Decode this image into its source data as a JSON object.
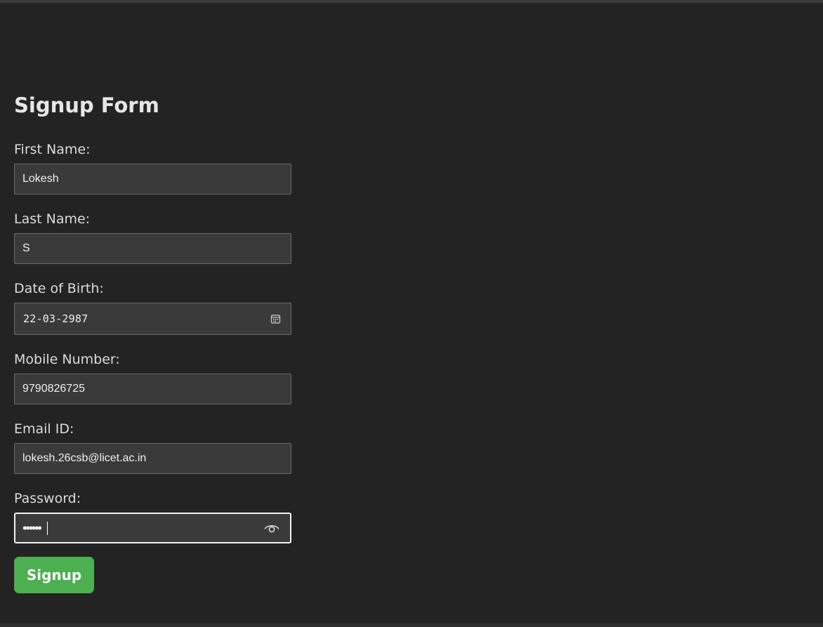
{
  "form": {
    "title": "Signup Form",
    "first_name": {
      "label": "First Name:",
      "value": "Lokesh"
    },
    "last_name": {
      "label": "Last Name:",
      "value": "S"
    },
    "dob": {
      "label": "Date of Birth:",
      "value": "22-03-2987",
      "icon": "calendar-icon"
    },
    "mobile": {
      "label": "Mobile Number:",
      "value": "9790826725"
    },
    "email": {
      "label": "Email ID:",
      "value": "lokesh.26csb@licet.ac.in"
    },
    "password": {
      "label": "Password:",
      "value": "••••••",
      "icon": "eye-icon"
    },
    "submit_label": "Signup"
  },
  "colors": {
    "background": "#232323",
    "input_bg": "#3a3a3a",
    "button": "#4caf50",
    "text": "#dcdcdc"
  }
}
